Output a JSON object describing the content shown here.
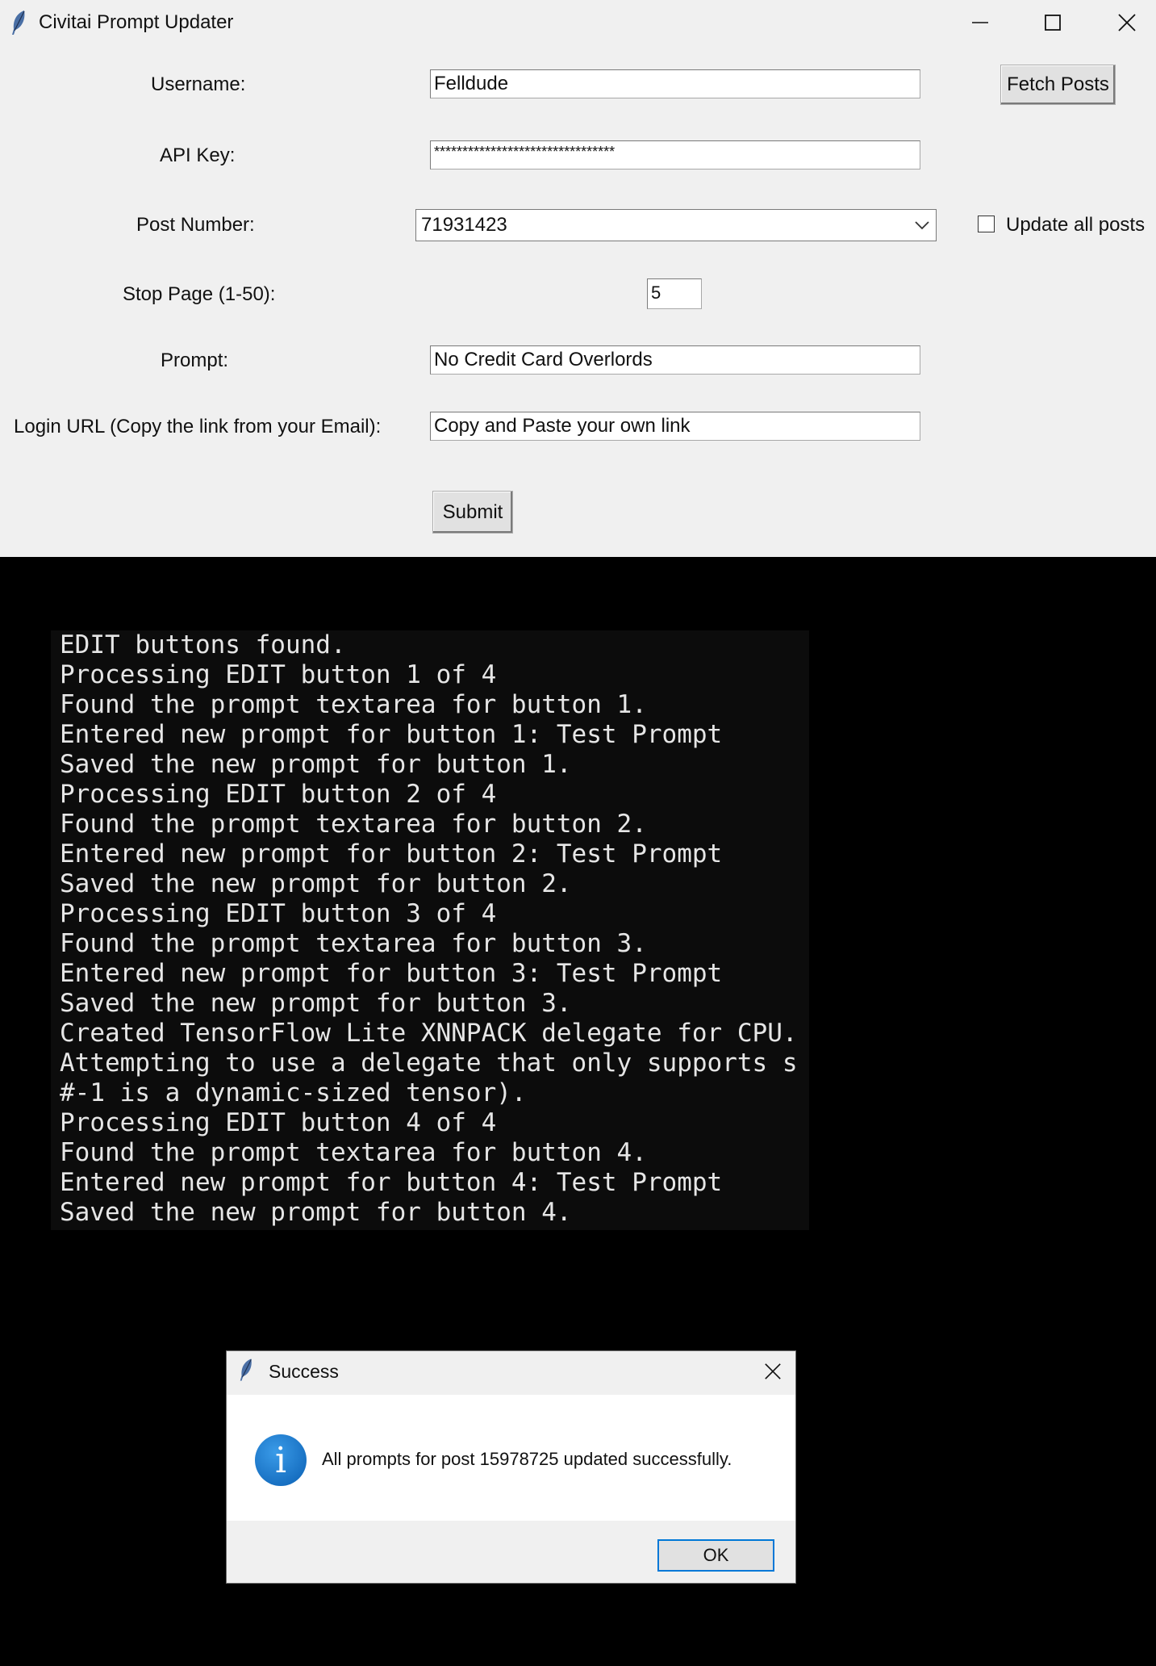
{
  "window": {
    "title": "Civitai Prompt Updater",
    "minimize_icon": "minimize-icon",
    "maximize_icon": "maximize-icon",
    "close_icon": "close-icon"
  },
  "form": {
    "username_label": "Username:",
    "username_value": "Felldude",
    "fetch_posts_label": "Fetch Posts",
    "api_key_label": "API Key:",
    "api_key_value": "********************************",
    "post_number_label": "Post Number:",
    "post_number_value": "71931423",
    "update_all_label": "Update all posts",
    "update_all_checked": false,
    "stop_page_label": "Stop Page (1-50):",
    "stop_page_value": "5",
    "prompt_label": "Prompt:",
    "prompt_value": "No Credit Card Overlords",
    "login_url_label": "Login URL (Copy the link from your Email):",
    "login_url_value": "Copy and Paste your own link",
    "submit_label": "Submit"
  },
  "console": {
    "lines": [
      "EDIT buttons found.",
      "Processing EDIT button 1 of 4",
      "Found the prompt textarea for button 1.",
      "Entered new prompt for button 1: Test Prompt",
      "Saved the new prompt for button 1.",
      "Processing EDIT button 2 of 4",
      "Found the prompt textarea for button 2.",
      "Entered new prompt for button 2: Test Prompt",
      "Saved the new prompt for button 2.",
      "Processing EDIT button 3 of 4",
      "Found the prompt textarea for button 3.",
      "Entered new prompt for button 3: Test Prompt",
      "Saved the new prompt for button 3.",
      "Created TensorFlow Lite XNNPACK delegate for CPU.",
      "Attempting to use a delegate that only supports s",
      "#-1 is a dynamic-sized tensor).",
      "Processing EDIT button 4 of 4",
      "Found the prompt textarea for button 4.",
      "Entered new prompt for button 4: Test Prompt",
      "Saved the new prompt for button 4."
    ]
  },
  "dialog": {
    "title": "Success",
    "message": "All prompts for post 15978725 updated successfully.",
    "ok_label": "OK",
    "icon": "info-icon"
  },
  "colors": {
    "window_bg": "#f0f0f0",
    "console_bg": "#0c0c0c",
    "console_text": "#e6e6e6",
    "accent": "#0078d7"
  }
}
